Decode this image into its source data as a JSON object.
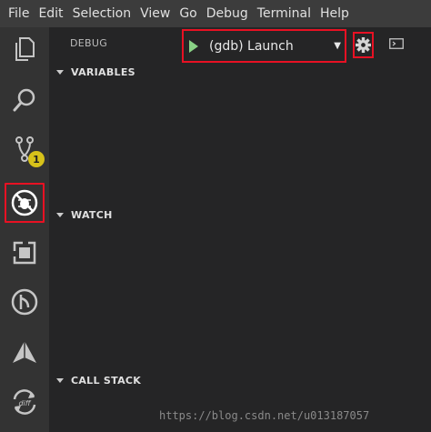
{
  "menu": [
    "File",
    "Edit",
    "Selection",
    "View",
    "Go",
    "Debug",
    "Terminal",
    "Help"
  ],
  "activity": {
    "scm_badge": "1"
  },
  "debug": {
    "title": "DEBUG",
    "config": "(gdb) Launch",
    "dropdown_arrow": "▼"
  },
  "sections": {
    "variables": "VARIABLES",
    "watch": "WATCH",
    "call_stack": "CALL STACK"
  },
  "watermark": "https://blog.csdn.net/u013187057",
  "colors": {
    "highlight_border": "#e81123",
    "play_green": "#89d185",
    "badge_yellow": "#d7c21a"
  }
}
